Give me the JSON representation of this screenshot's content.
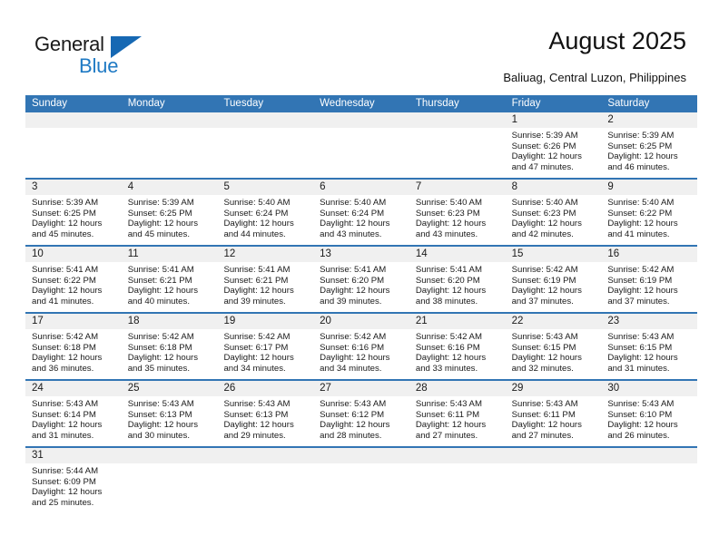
{
  "brand": {
    "name_top": "General",
    "name_bottom": "Blue",
    "triangle_color": "#1668b3",
    "blue_text_color": "#1f7ac4"
  },
  "header": {
    "title": "August 2025",
    "subtitle": "Baliuag, Central Luzon, Philippines"
  },
  "theme": {
    "accent": "#3275b6",
    "header_text": "#ffffff",
    "day_band": "#f0f0f0",
    "body_text": "#1a1a1a"
  },
  "calendar": {
    "weekdays": [
      "Sunday",
      "Monday",
      "Tuesday",
      "Wednesday",
      "Thursday",
      "Friday",
      "Saturday"
    ],
    "weeks": [
      [
        {
          "day": "",
          "lines": []
        },
        {
          "day": "",
          "lines": []
        },
        {
          "day": "",
          "lines": []
        },
        {
          "day": "",
          "lines": []
        },
        {
          "day": "",
          "lines": []
        },
        {
          "day": "1",
          "lines": [
            "Sunrise: 5:39 AM",
            "Sunset: 6:26 PM",
            "Daylight: 12 hours",
            "and 47 minutes."
          ]
        },
        {
          "day": "2",
          "lines": [
            "Sunrise: 5:39 AM",
            "Sunset: 6:25 PM",
            "Daylight: 12 hours",
            "and 46 minutes."
          ]
        }
      ],
      [
        {
          "day": "3",
          "lines": [
            "Sunrise: 5:39 AM",
            "Sunset: 6:25 PM",
            "Daylight: 12 hours",
            "and 45 minutes."
          ]
        },
        {
          "day": "4",
          "lines": [
            "Sunrise: 5:39 AM",
            "Sunset: 6:25 PM",
            "Daylight: 12 hours",
            "and 45 minutes."
          ]
        },
        {
          "day": "5",
          "lines": [
            "Sunrise: 5:40 AM",
            "Sunset: 6:24 PM",
            "Daylight: 12 hours",
            "and 44 minutes."
          ]
        },
        {
          "day": "6",
          "lines": [
            "Sunrise: 5:40 AM",
            "Sunset: 6:24 PM",
            "Daylight: 12 hours",
            "and 43 minutes."
          ]
        },
        {
          "day": "7",
          "lines": [
            "Sunrise: 5:40 AM",
            "Sunset: 6:23 PM",
            "Daylight: 12 hours",
            "and 43 minutes."
          ]
        },
        {
          "day": "8",
          "lines": [
            "Sunrise: 5:40 AM",
            "Sunset: 6:23 PM",
            "Daylight: 12 hours",
            "and 42 minutes."
          ]
        },
        {
          "day": "9",
          "lines": [
            "Sunrise: 5:40 AM",
            "Sunset: 6:22 PM",
            "Daylight: 12 hours",
            "and 41 minutes."
          ]
        }
      ],
      [
        {
          "day": "10",
          "lines": [
            "Sunrise: 5:41 AM",
            "Sunset: 6:22 PM",
            "Daylight: 12 hours",
            "and 41 minutes."
          ]
        },
        {
          "day": "11",
          "lines": [
            "Sunrise: 5:41 AM",
            "Sunset: 6:21 PM",
            "Daylight: 12 hours",
            "and 40 minutes."
          ]
        },
        {
          "day": "12",
          "lines": [
            "Sunrise: 5:41 AM",
            "Sunset: 6:21 PM",
            "Daylight: 12 hours",
            "and 39 minutes."
          ]
        },
        {
          "day": "13",
          "lines": [
            "Sunrise: 5:41 AM",
            "Sunset: 6:20 PM",
            "Daylight: 12 hours",
            "and 39 minutes."
          ]
        },
        {
          "day": "14",
          "lines": [
            "Sunrise: 5:41 AM",
            "Sunset: 6:20 PM",
            "Daylight: 12 hours",
            "and 38 minutes."
          ]
        },
        {
          "day": "15",
          "lines": [
            "Sunrise: 5:42 AM",
            "Sunset: 6:19 PM",
            "Daylight: 12 hours",
            "and 37 minutes."
          ]
        },
        {
          "day": "16",
          "lines": [
            "Sunrise: 5:42 AM",
            "Sunset: 6:19 PM",
            "Daylight: 12 hours",
            "and 37 minutes."
          ]
        }
      ],
      [
        {
          "day": "17",
          "lines": [
            "Sunrise: 5:42 AM",
            "Sunset: 6:18 PM",
            "Daylight: 12 hours",
            "and 36 minutes."
          ]
        },
        {
          "day": "18",
          "lines": [
            "Sunrise: 5:42 AM",
            "Sunset: 6:18 PM",
            "Daylight: 12 hours",
            "and 35 minutes."
          ]
        },
        {
          "day": "19",
          "lines": [
            "Sunrise: 5:42 AM",
            "Sunset: 6:17 PM",
            "Daylight: 12 hours",
            "and 34 minutes."
          ]
        },
        {
          "day": "20",
          "lines": [
            "Sunrise: 5:42 AM",
            "Sunset: 6:16 PM",
            "Daylight: 12 hours",
            "and 34 minutes."
          ]
        },
        {
          "day": "21",
          "lines": [
            "Sunrise: 5:42 AM",
            "Sunset: 6:16 PM",
            "Daylight: 12 hours",
            "and 33 minutes."
          ]
        },
        {
          "day": "22",
          "lines": [
            "Sunrise: 5:43 AM",
            "Sunset: 6:15 PM",
            "Daylight: 12 hours",
            "and 32 minutes."
          ]
        },
        {
          "day": "23",
          "lines": [
            "Sunrise: 5:43 AM",
            "Sunset: 6:15 PM",
            "Daylight: 12 hours",
            "and 31 minutes."
          ]
        }
      ],
      [
        {
          "day": "24",
          "lines": [
            "Sunrise: 5:43 AM",
            "Sunset: 6:14 PM",
            "Daylight: 12 hours",
            "and 31 minutes."
          ]
        },
        {
          "day": "25",
          "lines": [
            "Sunrise: 5:43 AM",
            "Sunset: 6:13 PM",
            "Daylight: 12 hours",
            "and 30 minutes."
          ]
        },
        {
          "day": "26",
          "lines": [
            "Sunrise: 5:43 AM",
            "Sunset: 6:13 PM",
            "Daylight: 12 hours",
            "and 29 minutes."
          ]
        },
        {
          "day": "27",
          "lines": [
            "Sunrise: 5:43 AM",
            "Sunset: 6:12 PM",
            "Daylight: 12 hours",
            "and 28 minutes."
          ]
        },
        {
          "day": "28",
          "lines": [
            "Sunrise: 5:43 AM",
            "Sunset: 6:11 PM",
            "Daylight: 12 hours",
            "and 27 minutes."
          ]
        },
        {
          "day": "29",
          "lines": [
            "Sunrise: 5:43 AM",
            "Sunset: 6:11 PM",
            "Daylight: 12 hours",
            "and 27 minutes."
          ]
        },
        {
          "day": "30",
          "lines": [
            "Sunrise: 5:43 AM",
            "Sunset: 6:10 PM",
            "Daylight: 12 hours",
            "and 26 minutes."
          ]
        }
      ],
      [
        {
          "day": "31",
          "lines": [
            "Sunrise: 5:44 AM",
            "Sunset: 6:09 PM",
            "Daylight: 12 hours",
            "and 25 minutes."
          ]
        },
        {
          "day": "",
          "lines": []
        },
        {
          "day": "",
          "lines": []
        },
        {
          "day": "",
          "lines": []
        },
        {
          "day": "",
          "lines": []
        },
        {
          "day": "",
          "lines": []
        },
        {
          "day": "",
          "lines": []
        }
      ]
    ]
  }
}
